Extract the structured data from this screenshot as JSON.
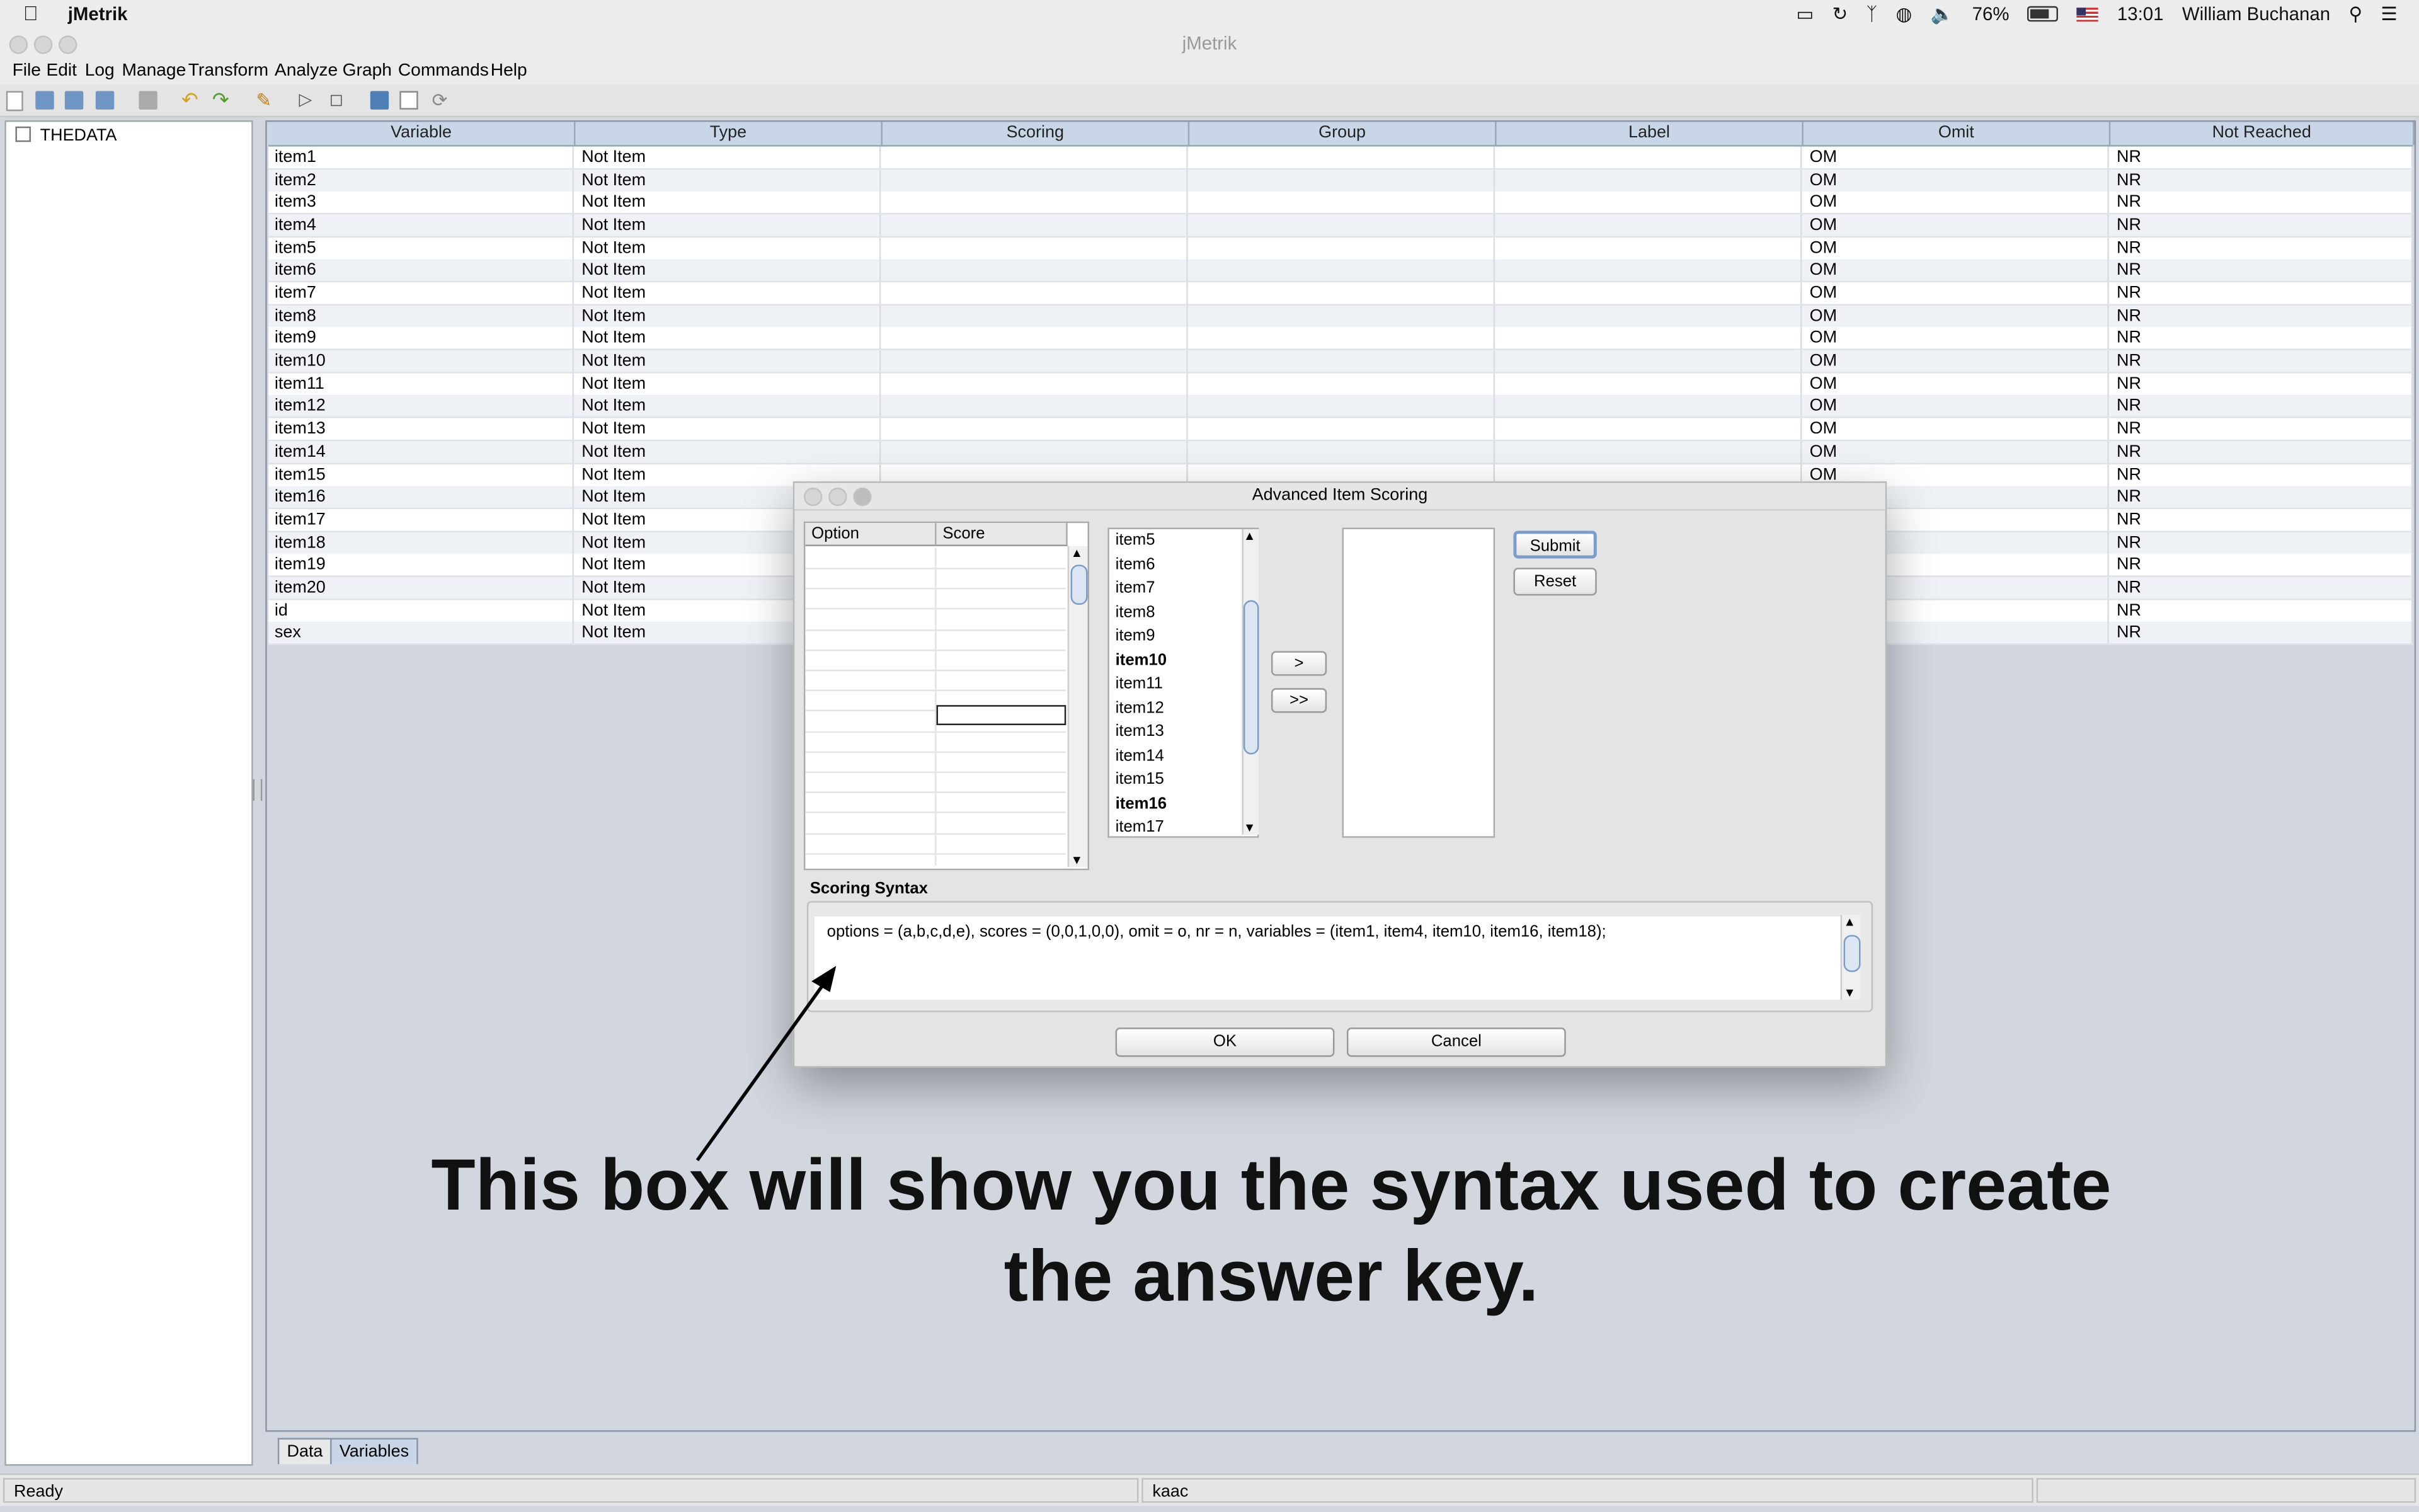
{
  "menubar": {
    "app_name": "jMetrik",
    "battery": "76%",
    "time": "13:01",
    "user": "William Buchanan"
  },
  "window": {
    "title": "jMetrik"
  },
  "menu": [
    "File",
    "Edit",
    "Log",
    "Manage",
    "Transform",
    "Analyze",
    "Graph",
    "Commands",
    "Help"
  ],
  "tree": {
    "root": "THEDATA"
  },
  "table": {
    "columns": [
      "Variable",
      "Type",
      "Scoring",
      "Group",
      "Label",
      "Omit",
      "Not Reached"
    ],
    "rows": [
      [
        "item1",
        "Not Item",
        "",
        "",
        "",
        "OM",
        "NR"
      ],
      [
        "item2",
        "Not Item",
        "",
        "",
        "",
        "OM",
        "NR"
      ],
      [
        "item3",
        "Not Item",
        "",
        "",
        "",
        "OM",
        "NR"
      ],
      [
        "item4",
        "Not Item",
        "",
        "",
        "",
        "OM",
        "NR"
      ],
      [
        "item5",
        "Not Item",
        "",
        "",
        "",
        "OM",
        "NR"
      ],
      [
        "item6",
        "Not Item",
        "",
        "",
        "",
        "OM",
        "NR"
      ],
      [
        "item7",
        "Not Item",
        "",
        "",
        "",
        "OM",
        "NR"
      ],
      [
        "item8",
        "Not Item",
        "",
        "",
        "",
        "OM",
        "NR"
      ],
      [
        "item9",
        "Not Item",
        "",
        "",
        "",
        "OM",
        "NR"
      ],
      [
        "item10",
        "Not Item",
        "",
        "",
        "",
        "OM",
        "NR"
      ],
      [
        "item11",
        "Not Item",
        "",
        "",
        "",
        "OM",
        "NR"
      ],
      [
        "item12",
        "Not Item",
        "",
        "",
        "",
        "OM",
        "NR"
      ],
      [
        "item13",
        "Not Item",
        "",
        "",
        "",
        "OM",
        "NR"
      ],
      [
        "item14",
        "Not Item",
        "",
        "",
        "",
        "OM",
        "NR"
      ],
      [
        "item15",
        "Not Item",
        "",
        "",
        "",
        "OM",
        "NR"
      ],
      [
        "item16",
        "Not Item",
        "",
        "",
        "",
        "",
        "NR"
      ],
      [
        "item17",
        "Not Item",
        "",
        "",
        "",
        "",
        "NR"
      ],
      [
        "item18",
        "Not Item",
        "",
        "",
        "",
        "",
        "NR"
      ],
      [
        "item19",
        "Not Item",
        "",
        "",
        "",
        "",
        "NR"
      ],
      [
        "item20",
        "Not Item",
        "",
        "",
        "",
        "",
        "NR"
      ],
      [
        "id",
        "Not Item",
        "",
        "",
        "",
        "",
        "NR"
      ],
      [
        "sex",
        "Not Item",
        "",
        "",
        "",
        "",
        "NR"
      ]
    ]
  },
  "tabs": [
    "Data",
    "Variables"
  ],
  "status": {
    "left": "Ready",
    "middle": "kaac"
  },
  "dialog": {
    "title": "Advanced Item Scoring",
    "option_header": "Option",
    "score_header": "Score",
    "items": [
      "item5",
      "item6",
      "item7",
      "item8",
      "item9",
      "item10",
      "item11",
      "item12",
      "item13",
      "item14",
      "item15",
      "item16",
      "item17"
    ],
    "bold_items": [
      "item10",
      "item16"
    ],
    "add_label": ">",
    "add_all_label": ">>",
    "submit_label": "Submit",
    "reset_label": "Reset",
    "syntax_label": "Scoring Syntax",
    "syntax_text": "options = (a,b,c,d,e), scores = (0,0,1,0,0), omit = o, nr = n, variables = (item1, item4, item10, item16, item18);",
    "ok_label": "OK",
    "cancel_label": "Cancel"
  },
  "annotation": {
    "line1": "This box will show you the syntax used to create",
    "line2": "the answer key."
  }
}
